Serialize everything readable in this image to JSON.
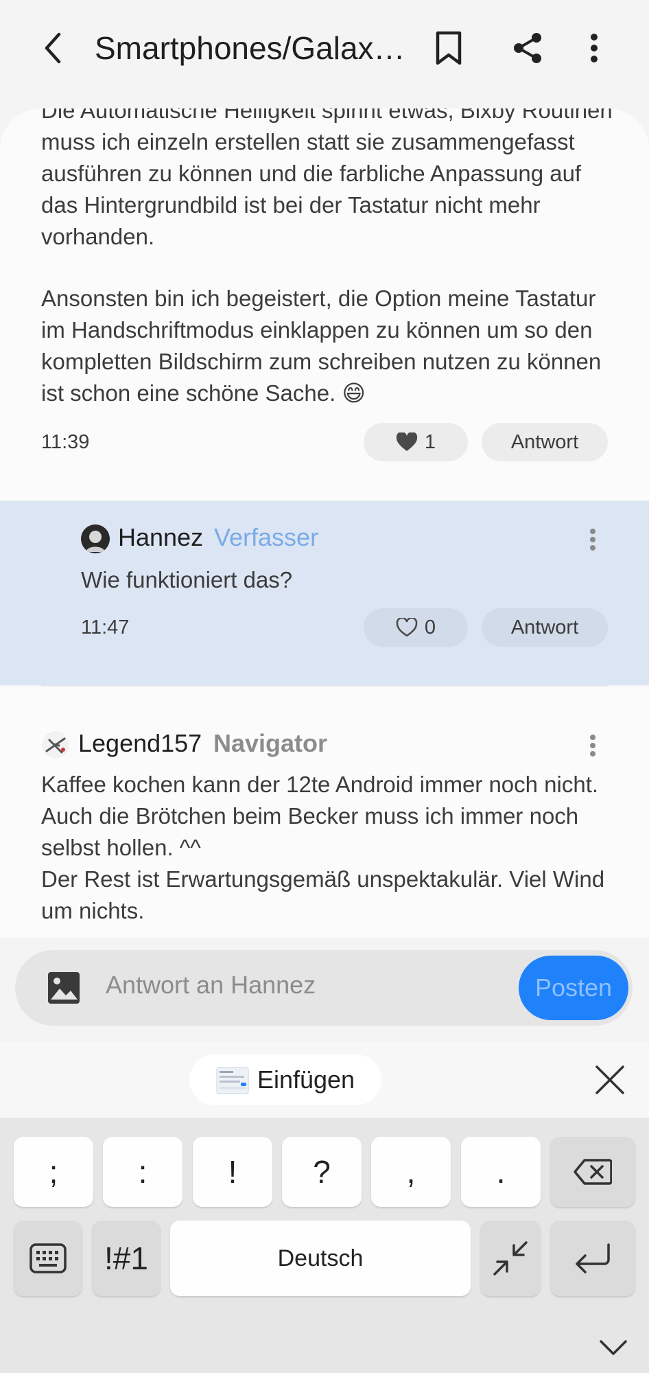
{
  "header": {
    "title": "Smartphones/Galax…"
  },
  "post": {
    "paragraph1": "Die Automatische Helligkeit spinnt etwas, Bixby Routinen muss ich einzeln erstellen statt sie zusammengefasst ausführen zu können und die farbliche Anpassung auf das Hintergrundbild ist bei der Tastatur nicht mehr vorhanden.",
    "paragraph2": "Ansonsten bin ich begeistert, die Option meine Tastatur im Handschriftmodus einklappen zu können um so den kompletten Bildschirm zum schreiben nutzen zu können ist schon eine schöne Sache. 😄",
    "time": "11:39",
    "like_count": "1",
    "reply_label": "Antwort"
  },
  "reply": {
    "author": "Hannez",
    "badge": "Verfasser",
    "text": "Wie funktioniert das?",
    "time": "11:47",
    "like_count": "0",
    "reply_label": "Antwort",
    "badge_color": "#7aaae8"
  },
  "comment": {
    "author": "Legend157",
    "rank": "Navigator",
    "text": "Kaffee kochen kann der 12te Android immer noch nicht. Auch die Brötchen beim Becker muss ich immer noch selbst hollen. ^^\nDer Rest ist Erwartungsgemäß unspektakulär. Viel Wind um nichts."
  },
  "composer": {
    "placeholder": "Antwort an Hannez",
    "post_label": "Posten",
    "accent": "#1f82fb"
  },
  "clipboard": {
    "label": "Einfügen"
  },
  "keyboard": {
    "row1": [
      ";",
      ":",
      "!",
      "?",
      ",",
      "."
    ],
    "symbols_label": "!#1",
    "space_label": "Deutsch"
  },
  "icons": [
    "back-arrow-icon",
    "bookmark-icon",
    "share-icon",
    "more-vert-icon",
    "heart-icon",
    "image-icon",
    "close-icon",
    "backspace-icon",
    "keyboard-icon",
    "collapse-icon",
    "enter-icon",
    "chevron-down-icon"
  ]
}
